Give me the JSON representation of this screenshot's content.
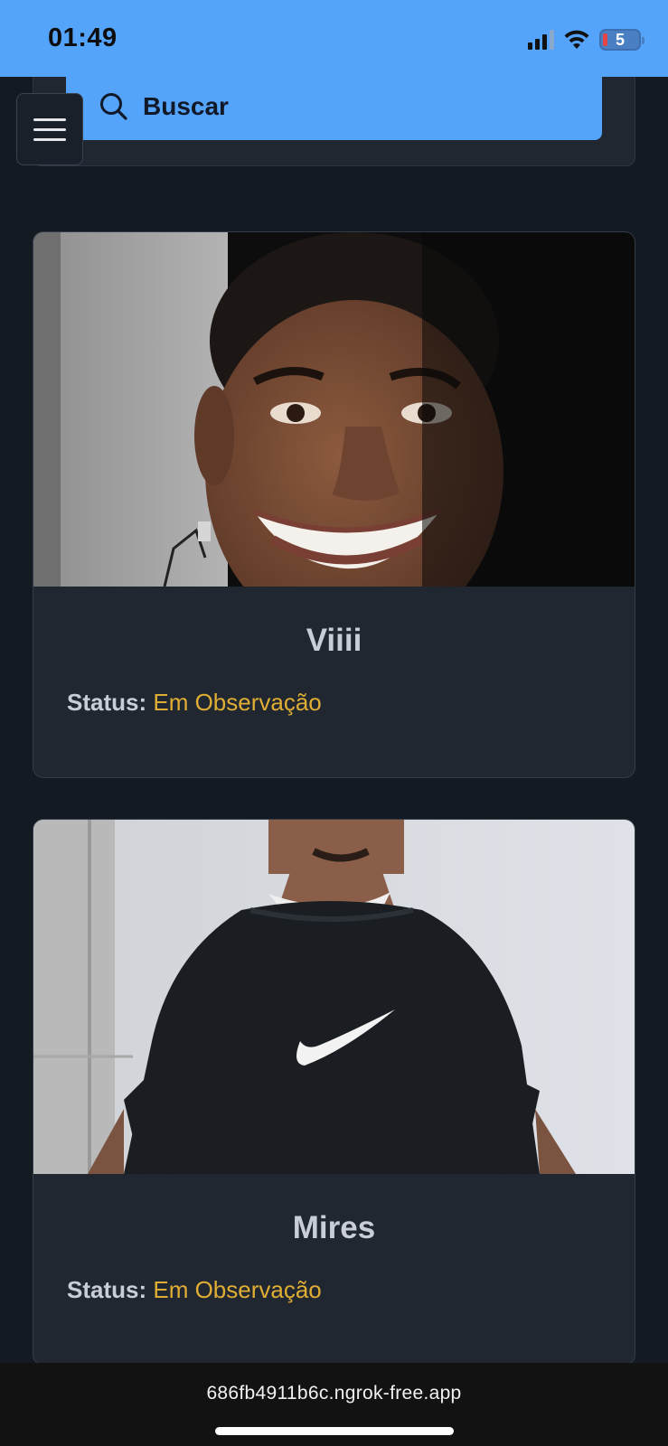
{
  "status_bar": {
    "time": "01:49",
    "battery_level": "5",
    "icons": [
      "cellular-signal-icon",
      "wifi-icon",
      "battery-icon"
    ]
  },
  "search": {
    "label": "Buscar",
    "icon": "search-icon"
  },
  "menu": {
    "icon": "hamburger-menu-icon"
  },
  "cards": [
    {
      "name": "Viiii",
      "status_label": "Status:",
      "status_value": "Em Observação"
    },
    {
      "name": "Mires",
      "status_label": "Status:",
      "status_value": "Em Observação"
    }
  ],
  "browser": {
    "url": "686fb4911b6c.ngrok-free.app"
  },
  "colors": {
    "accent": "#55a4fc",
    "background": "#141a21",
    "card": "#202731",
    "status_value": "#e0ae34"
  }
}
